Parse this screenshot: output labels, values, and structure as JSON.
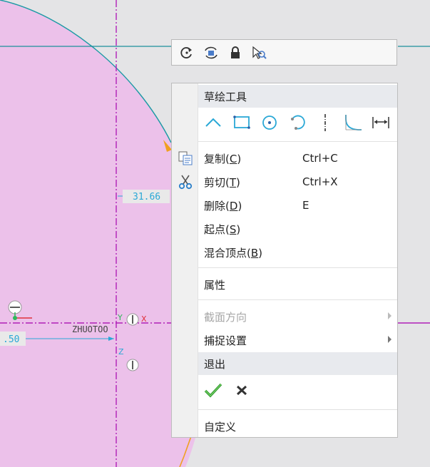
{
  "sketch": {
    "dimension_value": "31.66",
    "dimension_partial": ".50",
    "origin_label": "ZHUOTOO",
    "axis_x": "X",
    "axis_y": "Y",
    "axis_z": "Z"
  },
  "mini_toolbar": {
    "buttons": [
      {
        "icon": "refresh-icon"
      },
      {
        "icon": "sync-swap-icon"
      },
      {
        "icon": "lock-icon"
      },
      {
        "icon": "zoom-select-icon"
      }
    ]
  },
  "context_menu": {
    "header": "草绘工具",
    "tool_icons": [
      "line-chain-icon",
      "rectangle-icon",
      "circle-icon",
      "arc-icon",
      "centerline-icon",
      "fillet-icon",
      "dimension-icon"
    ],
    "copy": {
      "label": "复制",
      "mnemonic": "C",
      "shortcut": "Ctrl+C"
    },
    "cut": {
      "label": "剪切",
      "mnemonic": "T",
      "shortcut": "Ctrl+X"
    },
    "delete": {
      "label": "删除",
      "mnemonic": "D",
      "shortcut": "E"
    },
    "start_point": {
      "label": "起点",
      "mnemonic": "S"
    },
    "blend_vertex": {
      "label": "混合顶点",
      "mnemonic": "B"
    },
    "properties": "属性",
    "section_direction": "截面方向",
    "snap_settings": "捕捉设置",
    "exit": "退出",
    "customize": "自定义",
    "colors": {
      "highlight": "#e8eaee",
      "ok_check": "#2e9a2e"
    }
  }
}
